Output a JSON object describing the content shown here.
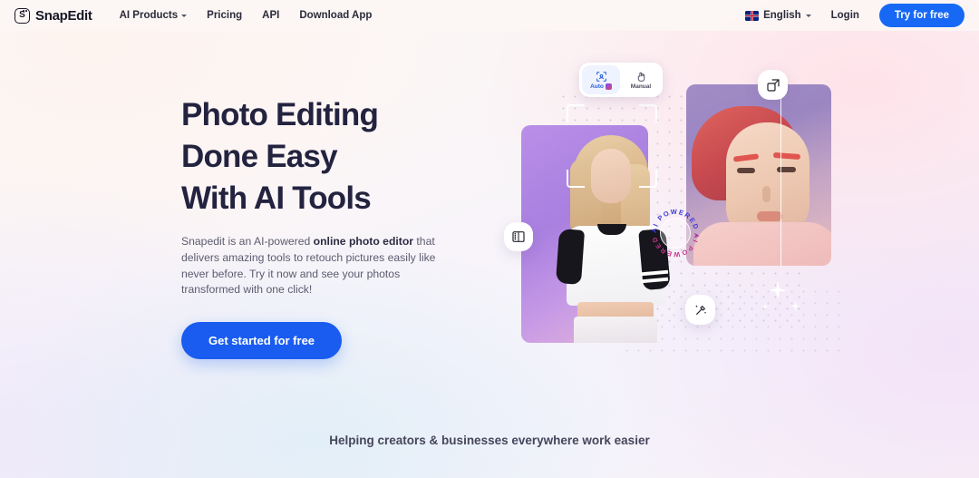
{
  "header": {
    "brand": {
      "logo_letter": "S",
      "name": "SnapEdit"
    },
    "nav": [
      {
        "label": "AI Products",
        "has_caret": true
      },
      {
        "label": "Pricing",
        "has_caret": false
      },
      {
        "label": "API",
        "has_caret": false
      },
      {
        "label": "Download App",
        "has_caret": false
      }
    ],
    "language": {
      "label": "English",
      "flag": "uk-flag-icon"
    },
    "login_label": "Login",
    "try_label": "Try for free"
  },
  "hero": {
    "heading_line1": "Photo Editing",
    "heading_line2": "Done Easy",
    "heading_line3": "With AI Tools",
    "paragraph_part1": "Snapedit is an AI-powered ",
    "paragraph_bold": "online photo editor",
    "paragraph_part2": " that delivers amazing tools to retouch pictures easily like never before. Try it now and see your photos transformed with one click!",
    "cta_label": "Get started for free"
  },
  "art": {
    "toolbar": {
      "auto_label": "Auto",
      "auto_badge": "ai-badge-icon",
      "auto_icon": "face-detect-icon",
      "manual_label": "Manual",
      "manual_icon": "hand-pointer-icon"
    },
    "chips": [
      {
        "name": "remove-background-icon"
      },
      {
        "name": "image-enlarger-icon"
      },
      {
        "name": "magic-wand-icon"
      }
    ],
    "badge_text": "AI POWERED • AI POWERED •"
  },
  "tagline": "Helping creators & businesses everywhere work easier",
  "colors": {
    "accent_blue": "#1a5cf0",
    "header_blue": "#1769f5",
    "heading": "#232340",
    "body_text": "#5c5c70"
  }
}
